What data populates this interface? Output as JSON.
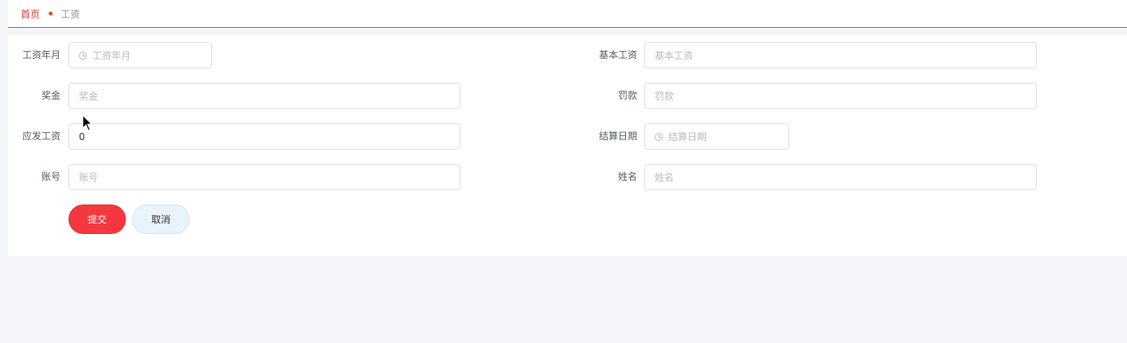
{
  "breadcrumb": {
    "home": "首页",
    "current": "工资"
  },
  "form": {
    "salary_month": {
      "label": "工资年月",
      "placeholder": "工资年月"
    },
    "basic_salary": {
      "label": "基本工资",
      "placeholder": "基本工资"
    },
    "bonus": {
      "label": "奖金",
      "placeholder": "奖金"
    },
    "penalty": {
      "label": "罚款",
      "placeholder": "罚款"
    },
    "gross_salary": {
      "label": "应发工资",
      "value": "0"
    },
    "settlement_date": {
      "label": "结算日期",
      "placeholder": "结算日期"
    },
    "account": {
      "label": "账号",
      "placeholder": "账号"
    },
    "name": {
      "label": "姓名",
      "placeholder": "姓名"
    }
  },
  "buttons": {
    "submit": "提交",
    "cancel": "取消"
  },
  "colors": {
    "accent_red": "#f5383d",
    "header_line": "#2d8ea8",
    "cancel_bg": "#e8f3fc"
  }
}
